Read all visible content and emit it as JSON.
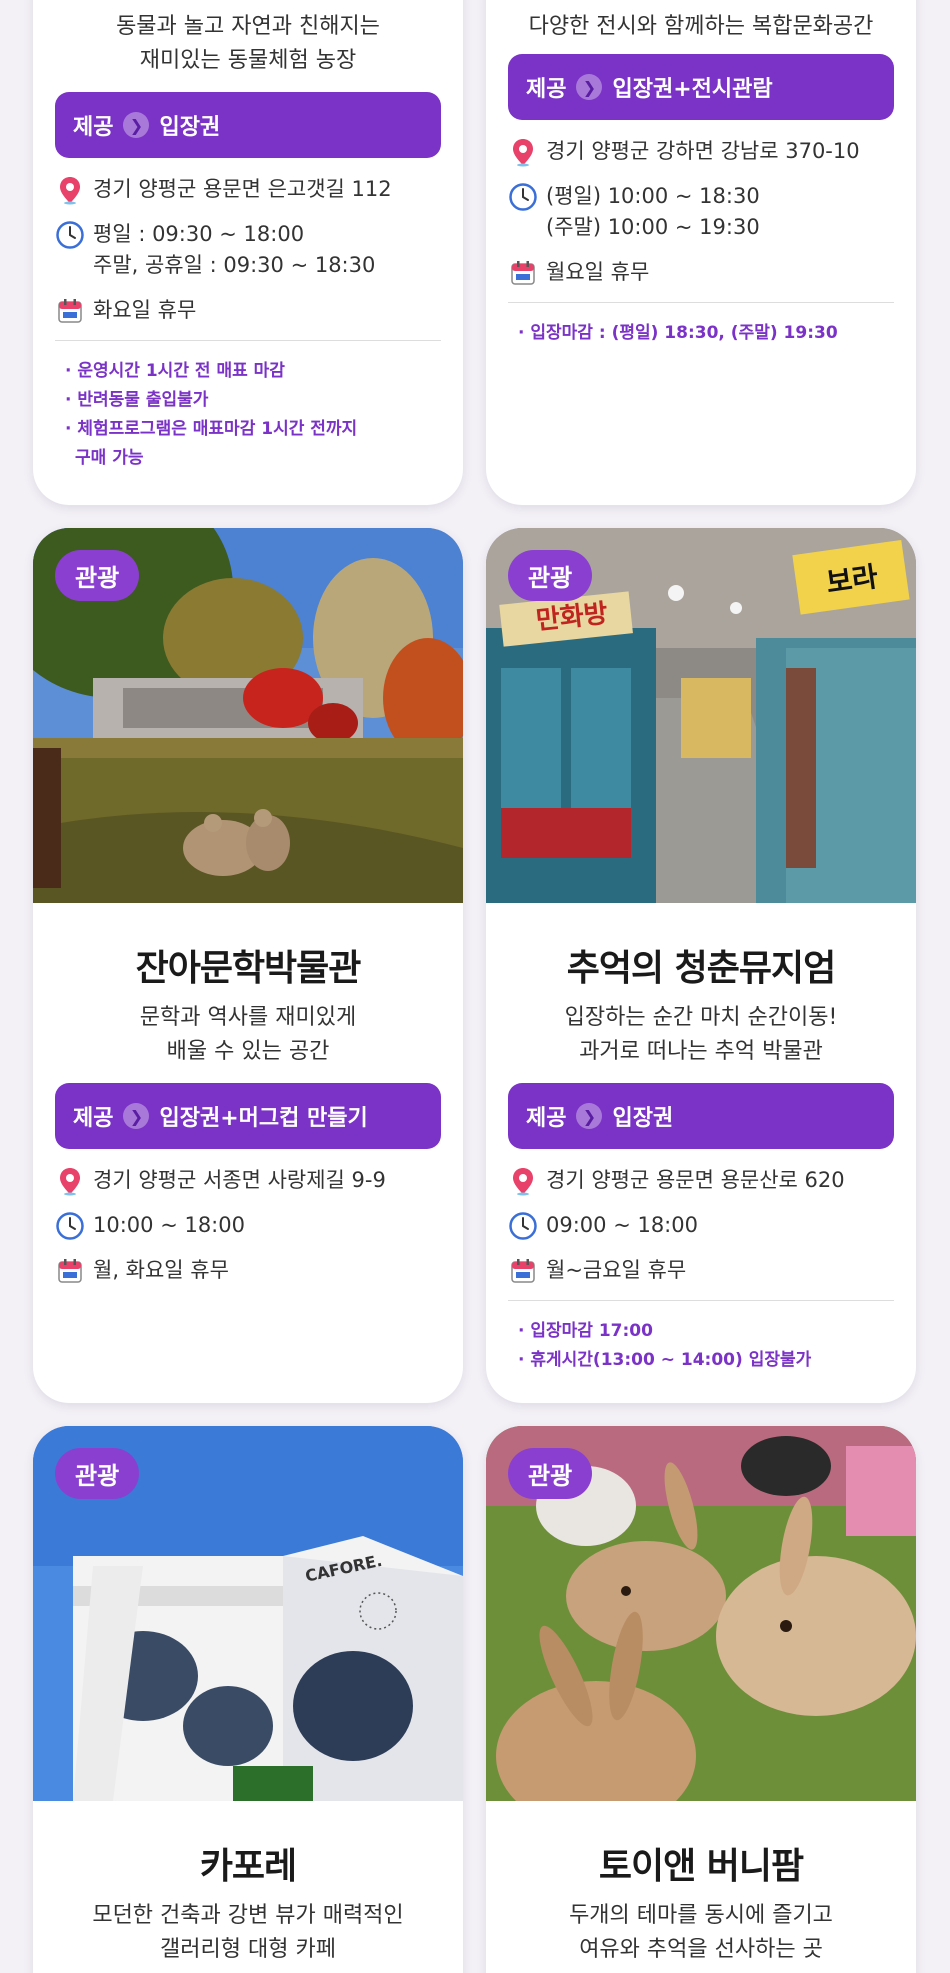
{
  "colors": {
    "accent": "#7b32c6",
    "tag": "#8a3fd1",
    "pin": "#e8416a",
    "clock": "#3b6fd8"
  },
  "provide_label": "제공",
  "cards": [
    {
      "desc1": "동물과 놀고 자연과 친해지는",
      "desc2": "재미있는 동물체험 농장",
      "provide": "입장권",
      "address": "경기 양평군 용문면 은고갯길 112",
      "hours1": "평일 : 09:30 ~ 18:00",
      "hours2": "주말, 공휴일 : 09:30 ~ 18:30",
      "closed": "화요일 휴무",
      "notes": [
        "· 운영시간 1시간 전 매표 마감",
        "· 반려동물 출입불가",
        "· 체험프로그램은 매표마감 1시간 전까지",
        "구매 가능"
      ]
    },
    {
      "desc1": "다양한 전시와 함께하는 복합문화공간",
      "provide": "입장권+전시관람",
      "address": "경기 양평군 강하면 강남로 370-10",
      "hours1": "(평일) 10:00 ~ 18:30",
      "hours2": "(주말) 10:00 ~ 19:30",
      "closed": "월요일 휴무",
      "notes": [
        "· 입장마감 : (평일) 18:30, (주말) 19:30"
      ]
    },
    {
      "tag": "관광",
      "name": "잔아문학박물관",
      "desc1": "문학과 역사를 재미있게",
      "desc2": "배울 수 있는 공간",
      "provide": "입장권+머그컵 만들기",
      "address": "경기 양평군 서종면 사랑제길 9-9",
      "hours1": "10:00 ~ 18:00",
      "closed": "월, 화요일 휴무"
    },
    {
      "tag": "관광",
      "name": "추억의 청춘뮤지엄",
      "desc1": "입장하는 순간 마치 순간이동!",
      "desc2": "과거로 떠나는 추억 박물관",
      "provide": "입장권",
      "address": "경기 양평군 용문면 용문산로 620",
      "hours1": "09:00 ~ 18:00",
      "closed": "월~금요일 휴무",
      "notes": [
        "· 입장마감 17:00",
        "· 휴게시간(13:00 ~ 14:00) 입장불가"
      ],
      "signs": {
        "comic": "만화방",
        "bora": "보라"
      }
    },
    {
      "tag": "관광",
      "name": "카포레",
      "desc1": "모던한 건축과 강변 뷰가 매력적인",
      "desc2": "갤러리형 대형 카페",
      "sign": "CAFORE."
    },
    {
      "tag": "관광",
      "name": "토이앤 버니팜",
      "desc1": "두개의 테마를 동시에 즐기고",
      "desc2": "여유와 추억을 선사하는 곳"
    }
  ]
}
